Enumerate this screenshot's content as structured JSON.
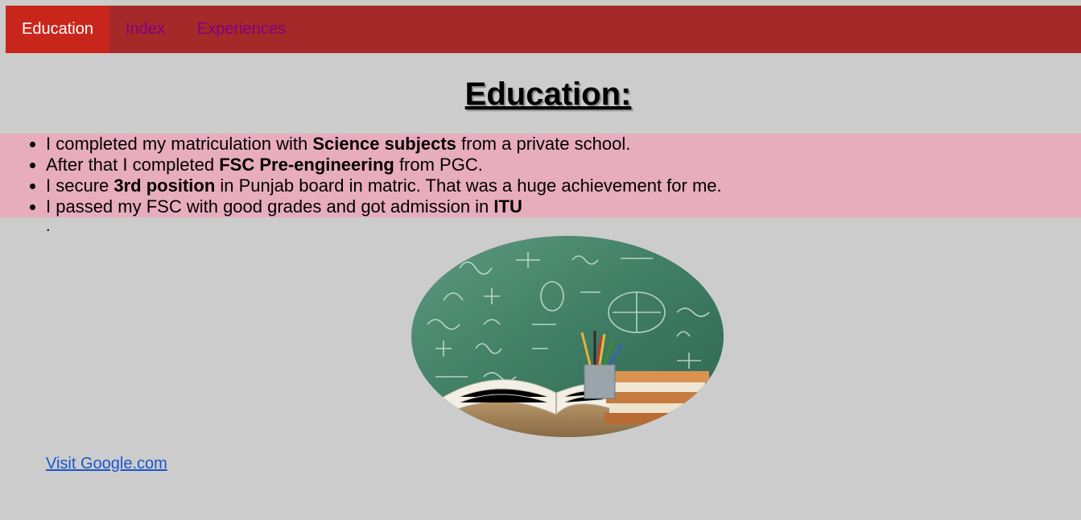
{
  "nav": {
    "items": [
      {
        "label": "Education",
        "active": true
      },
      {
        "label": "Index",
        "active": false
      },
      {
        "label": "Experiences",
        "active": false
      }
    ]
  },
  "page": {
    "title": "Education:",
    "list": [
      {
        "pre": "I completed my matriculation with ",
        "bold": "Science subjects",
        "post": " from a private school."
      },
      {
        "pre": "After that I completed ",
        "bold": "FSC Pre-engineering",
        "post": " from PGC."
      },
      {
        "pre": "I secure ",
        "bold": "3rd position",
        "post": " in Punjab board in matric. That was a huge achievement for me."
      },
      {
        "pre": "I passed my FSC with good grades and got admission in ",
        "bold": "ITU",
        "post": ""
      }
    ],
    "trailing_dot": ".",
    "link_label": "Visit Google.com"
  },
  "colors": {
    "nav_bg": "#a52929",
    "nav_active": "#c9261b",
    "list_highlight": "#e8acbf",
    "page_bg": "#cccccc",
    "link": "#1a57c9"
  }
}
